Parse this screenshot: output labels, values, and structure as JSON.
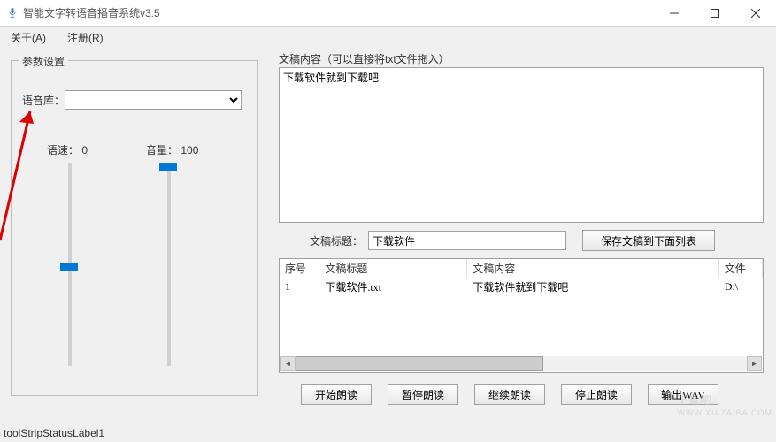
{
  "window": {
    "title": "智能文字转语音播音系统v3.5"
  },
  "menu": {
    "about": "关于(A)",
    "register": "注册(R)"
  },
  "params": {
    "panel_title": "参数设置",
    "voice_lib_label": "语音库：",
    "voice_lib_value": "",
    "speed_label": "语速：",
    "speed_value": "0",
    "volume_label": "音量：",
    "volume_value": "100"
  },
  "content": {
    "section_label": "文稿内容（可以直接将txt文件拖入）",
    "text_value": "下载软件就到下载吧",
    "title_label": "文稿标题：",
    "title_value": "下载软件",
    "save_button": "保存文稿到下面列表"
  },
  "list": {
    "columns": {
      "seq": "序号",
      "title": "文稿标题",
      "content": "文稿内容",
      "path": "文件"
    },
    "rows": [
      {
        "seq": "1",
        "title": "下载软件.txt",
        "content": "下载软件就到下载吧",
        "path": "D:\\"
      }
    ]
  },
  "buttons": {
    "start": "开始朗读",
    "pause": "暂停朗读",
    "resume": "继续朗读",
    "stop": "停止朗读",
    "output": "输出WAV"
  },
  "status": {
    "text": "toolStripStatusLabel1"
  },
  "watermark": {
    "main": "下载吧",
    "sub": "WWW.XIAZAIBA.COM"
  }
}
